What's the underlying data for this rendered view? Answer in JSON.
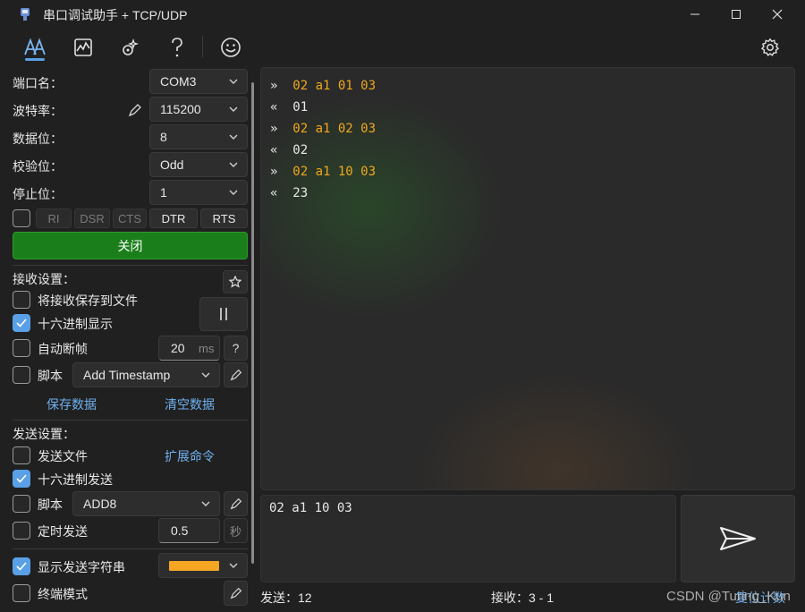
{
  "window": {
    "title": "串口调试助手 + TCP/UDP"
  },
  "toolbar": {
    "icons": [
      "serial-icon",
      "chart-icon",
      "plugin-icon",
      "help-icon",
      "smile-icon",
      "settings-icon"
    ]
  },
  "serial": {
    "port": {
      "label": "端口名：",
      "value": "COM3"
    },
    "baud": {
      "label": "波特率：",
      "value": "115200"
    },
    "databits": {
      "label": "数据位：",
      "value": "8"
    },
    "parity": {
      "label": "校验位：",
      "value": "Odd"
    },
    "stopbits": {
      "label": "停止位：",
      "value": "1"
    },
    "signals": {
      "ri": "RI",
      "dsr": "DSR",
      "cts": "CTS",
      "dtr": "DTR",
      "rts": "RTS"
    },
    "close_button": "关闭"
  },
  "receive": {
    "heading": "接收设置：",
    "save_to_file": {
      "label": "将接收保存到文件",
      "checked": false
    },
    "hex_display": {
      "label": "十六进制显示",
      "checked": true
    },
    "auto_frame": {
      "label": "自动断帧",
      "checked": false,
      "value": "20",
      "unit": "ms",
      "help": "?"
    },
    "script": {
      "label": "脚本",
      "checked": false,
      "value": "Add Timestamp"
    },
    "save_data": "保存数据",
    "clear_data": "清空数据"
  },
  "send": {
    "heading": "发送设置：",
    "send_file": {
      "label": "发送文件",
      "checked": false
    },
    "ext_commands": "扩展命令",
    "hex_send": {
      "label": "十六进制发送",
      "checked": true
    },
    "script": {
      "label": "脚本",
      "checked": false,
      "value": "ADD8"
    },
    "timed_send": {
      "label": "定时发送",
      "checked": false,
      "value": "0.5",
      "unit": "秒"
    },
    "show_send_string": {
      "label": "显示发送字符串",
      "checked": true,
      "color": "#f5a623"
    },
    "terminal_mode": {
      "label": "终端模式",
      "checked": false
    }
  },
  "log": [
    {
      "dir": "»",
      "text": "02 a1 01 03",
      "kind": "tx"
    },
    {
      "dir": "«",
      "text": "01",
      "kind": "rx"
    },
    {
      "dir": "»",
      "text": "02 a1 02 03",
      "kind": "tx"
    },
    {
      "dir": "«",
      "text": "02",
      "kind": "rx"
    },
    {
      "dir": "»",
      "text": "02 a1 10 03",
      "kind": "tx"
    },
    {
      "dir": "«",
      "text": "23",
      "kind": "rx"
    }
  ],
  "send_input": {
    "value": "02 a1 10 03"
  },
  "status": {
    "sent": "发送：12",
    "received": "接收：3 - 1",
    "reset": "复位计数"
  },
  "watermark": "CSDN @Turing_Kun",
  "colors": {
    "accent": "#5aa0e6",
    "tx_text": "#f0a81c",
    "close_button": "#1a7e1a",
    "link": "#6fb1ef"
  }
}
